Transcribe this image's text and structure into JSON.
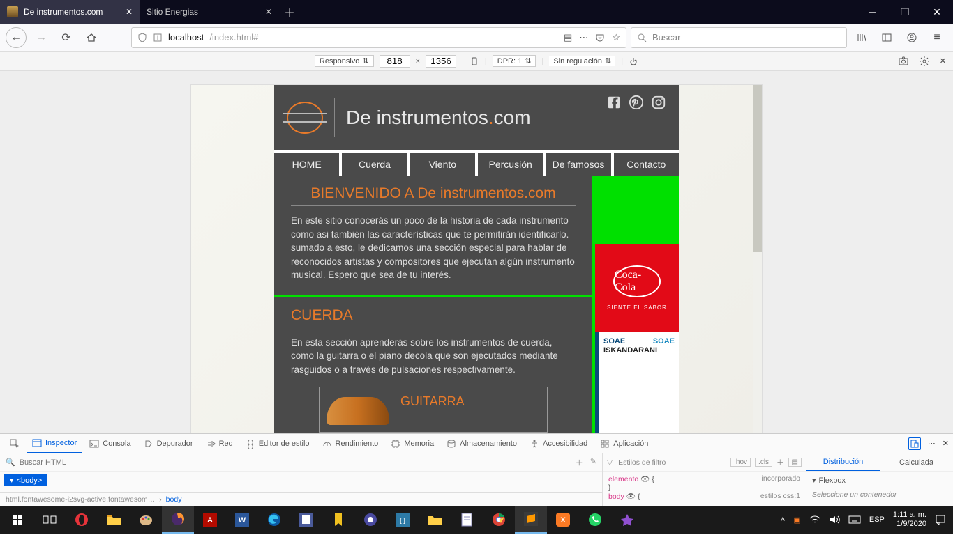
{
  "browser": {
    "tabs": [
      {
        "title": "De instrumentos.com",
        "active": true
      },
      {
        "title": "Sitio Energias",
        "active": false
      }
    ],
    "url_host": "localhost",
    "url_path": "/index.html#",
    "search_placeholder": "Buscar"
  },
  "rdm": {
    "mode": "Responsivo",
    "width": "818",
    "height": "1356",
    "dpr_label": "DPR: 1",
    "throttle": "Sin regulación"
  },
  "site": {
    "title_a": "De instrumentos",
    "title_b": ".com",
    "nav": [
      "HOME",
      "Cuerda",
      "Viento",
      "Percusión",
      "De famosos",
      "Contacto"
    ],
    "welcome": {
      "heading": "BIENVENIDO A De instrumentos.com",
      "body": "En este sitio conocerás un poco de la historia de cada instrumento como asi también las características que te permitirán identificarlo. sumado a esto, le dedicamos una sección especial para hablar de reconocidos artistas y compositores que ejecutan algún instrumento musical. Espero que sea de tu interés."
    },
    "cuerda": {
      "heading": "CUERDA",
      "body": "En esta sección aprenderás sobre los instrumentos de cuerda, como la guitarra o el piano decola que son ejecutados mediante rasguidos o a través de pulsaciones respectivamente.",
      "item_title": "GUITARRA"
    },
    "ads": {
      "coke_script": "Coca-Cola",
      "coke_tag": "SIENTE EL SABOR",
      "soae1": "SOAE",
      "soae2": "SOAE",
      "soae3": "ISKANDARANI"
    }
  },
  "devtools": {
    "tabs": [
      "Inspector",
      "Consola",
      "Depurador",
      "Red",
      "Editor de estilo",
      "Rendimiento",
      "Memoria",
      "Almacenamiento",
      "Accesibilidad",
      "Aplicación"
    ],
    "search_placeholder": "Buscar HTML",
    "selected_tag": "<body>",
    "breadcrumb_a": "html.fontawesome-i2svg-active.fontawesom…",
    "breadcrumb_b": "body",
    "styles_filter": "Estilos de filtro",
    "hov": ":hov",
    "cls": ".cls",
    "rule1a": "elemento",
    "rule1b": "incorporado",
    "rule2a": "body",
    "rule2b": "estilos css:1",
    "layout_tabs": [
      "Distribución",
      "Calculada"
    ],
    "flexbox": "Flexbox",
    "flexbox_hint": "Seleccione un contenedor"
  },
  "taskbar": {
    "lang": "ESP",
    "time": "1:11 a. m.",
    "date": "1/9/2020"
  }
}
